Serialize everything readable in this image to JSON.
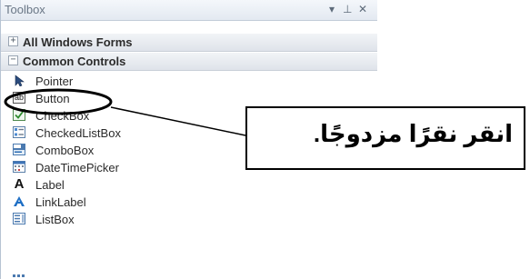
{
  "toolbox": {
    "title": "Toolbox",
    "controls": {
      "dropdown": "▾",
      "pin": "⊥",
      "close": "✕"
    },
    "sections": [
      {
        "label": "All Windows Forms",
        "expander": "+"
      },
      {
        "label": "Common Controls",
        "expander": "−"
      }
    ],
    "items": [
      {
        "label": "Pointer",
        "icon": "pointer-icon"
      },
      {
        "label": "Button",
        "icon": "button-icon"
      },
      {
        "label": "CheckBox",
        "icon": "checkbox-icon"
      },
      {
        "label": "CheckedListBox",
        "icon": "checkedlistbox-icon"
      },
      {
        "label": "ComboBox",
        "icon": "combobox-icon"
      },
      {
        "label": "DateTimePicker",
        "icon": "datetimepicker-icon"
      },
      {
        "label": "Label",
        "icon": "label-icon"
      },
      {
        "label": "LinkLabel",
        "icon": "linklabel-icon"
      },
      {
        "label": "ListBox",
        "icon": "listbox-icon"
      }
    ],
    "button_icon_text": "ab",
    "label_icon_text": "A"
  },
  "callout": {
    "text": "انقر نقرًا مزدوجًا."
  },
  "colors": {
    "accent": "#1f6fc5",
    "callout_border": "#000000"
  }
}
